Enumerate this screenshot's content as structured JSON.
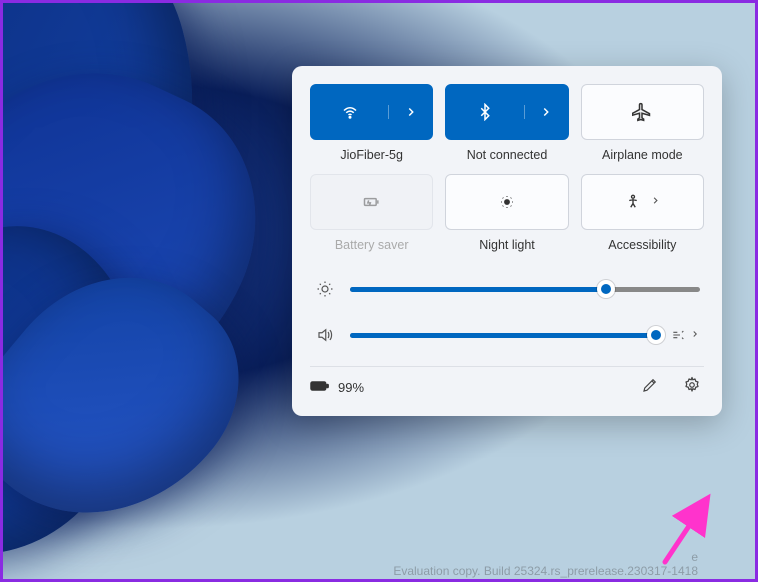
{
  "colors": {
    "accent": "#0067c0",
    "panel_bg": "#f2f4f8",
    "frame_border": "#8a2be2",
    "arrow": "#ff33cc"
  },
  "tiles": {
    "wifi": {
      "label": "JioFiber-5g",
      "active": true,
      "expandable": true
    },
    "bluetooth": {
      "label": "Not connected",
      "active": true,
      "expandable": true
    },
    "airplane": {
      "label": "Airplane mode",
      "active": false,
      "expandable": false
    },
    "battery_saver": {
      "label": "Battery saver",
      "active": false,
      "disabled": true
    },
    "night_light": {
      "label": "Night light",
      "active": false
    },
    "accessibility": {
      "label": "Accessibility",
      "active": false,
      "chevron": true
    }
  },
  "sliders": {
    "brightness": {
      "value": 73
    },
    "volume": {
      "value": 100
    }
  },
  "footer": {
    "battery_percent": "99%"
  },
  "watermark": {
    "line1": "e",
    "line2": "Evaluation copy. Build 25324.rs_prerelease.230317-1418"
  }
}
